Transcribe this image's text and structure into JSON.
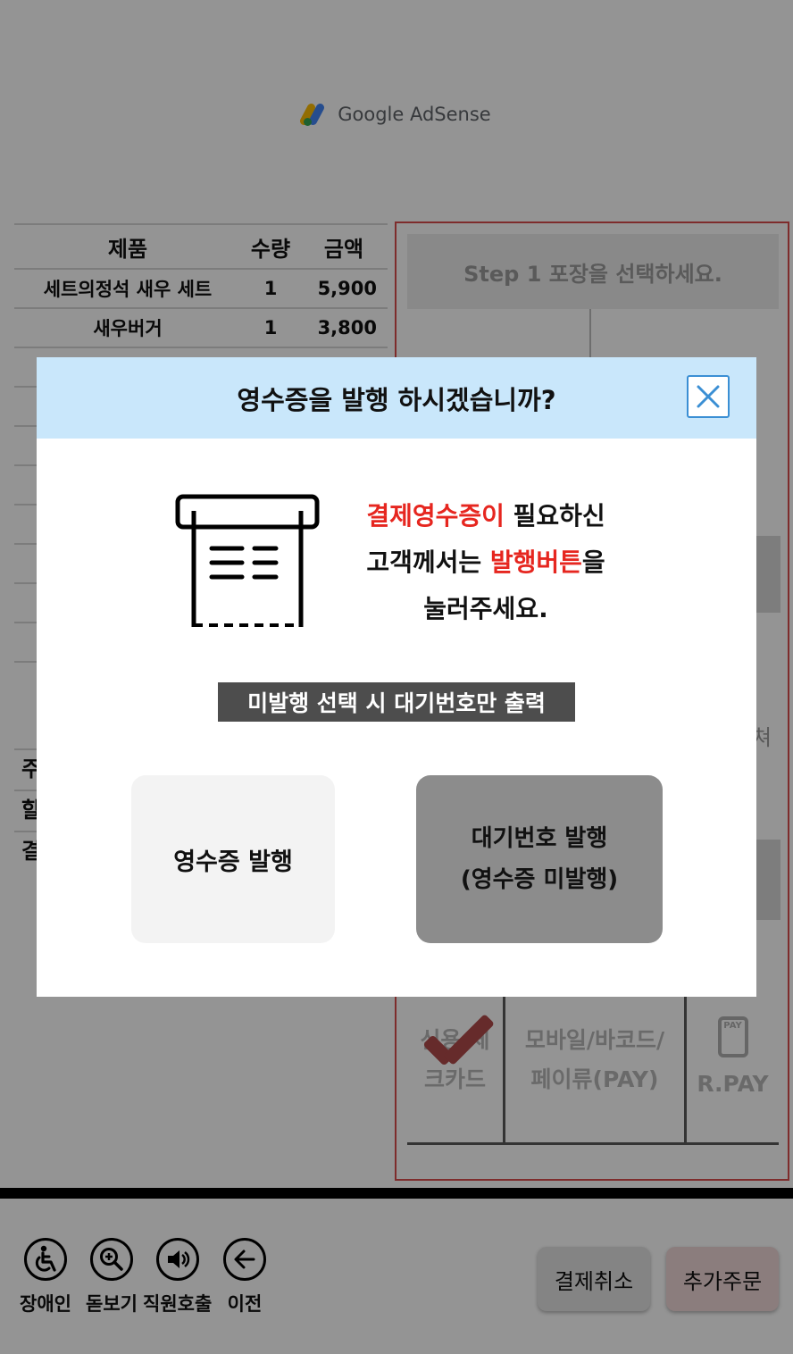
{
  "ad": {
    "brand": "Google AdSense"
  },
  "order_table": {
    "headers": {
      "product": "제품",
      "qty": "수량",
      "amount": "금액"
    },
    "rows": [
      {
        "product": "세트의정석 새우 세트",
        "qty": "1",
        "amount": "5,900"
      },
      {
        "product": "새우버거",
        "qty": "1",
        "amount": "3,800"
      }
    ]
  },
  "summary": {
    "row1": "주",
    "row2": "할",
    "row3": "결"
  },
  "payment_panel": {
    "step_title": "Step 1 포장을 선택하세요.",
    "side_char": "쳐",
    "methods": [
      {
        "line1": "신용/체",
        "line2": "크카드"
      },
      {
        "line1": "모바일/바코드/",
        "line2": "페이류(PAY)"
      },
      {
        "line1": "R.PAY",
        "line2": ""
      }
    ],
    "pay_badge": "PAY"
  },
  "bottom_bar": {
    "accessibility": [
      {
        "icon": "wheelchair-icon",
        "label": "장애인"
      },
      {
        "icon": "magnifier-icon",
        "label": "돋보기"
      },
      {
        "icon": "speaker-icon",
        "label": "직원호출"
      },
      {
        "icon": "back-arrow-icon",
        "label": "이전"
      }
    ],
    "cancel_label": "결제취소",
    "add_label": "추가주문"
  },
  "modal": {
    "title": "영수증을 발행 하시겠습니까?",
    "message": {
      "line1_red": "결제영수증이",
      "line1_rest": " 필요하신",
      "line2_start": "고객께서는 ",
      "line2_red": "발행버튼",
      "line2_end": "을",
      "line3": "눌러주세요."
    },
    "notice": "미발행 선택 시 대기번호만 출력",
    "issue_label": "영수증 발행",
    "wait_line1": "대기번호 발행",
    "wait_line2": "(영수증 미발행)",
    "colors": {
      "header_bg": "#c9e7fb",
      "highlight": "#e6261f",
      "close_border": "#3b8fd4"
    }
  }
}
